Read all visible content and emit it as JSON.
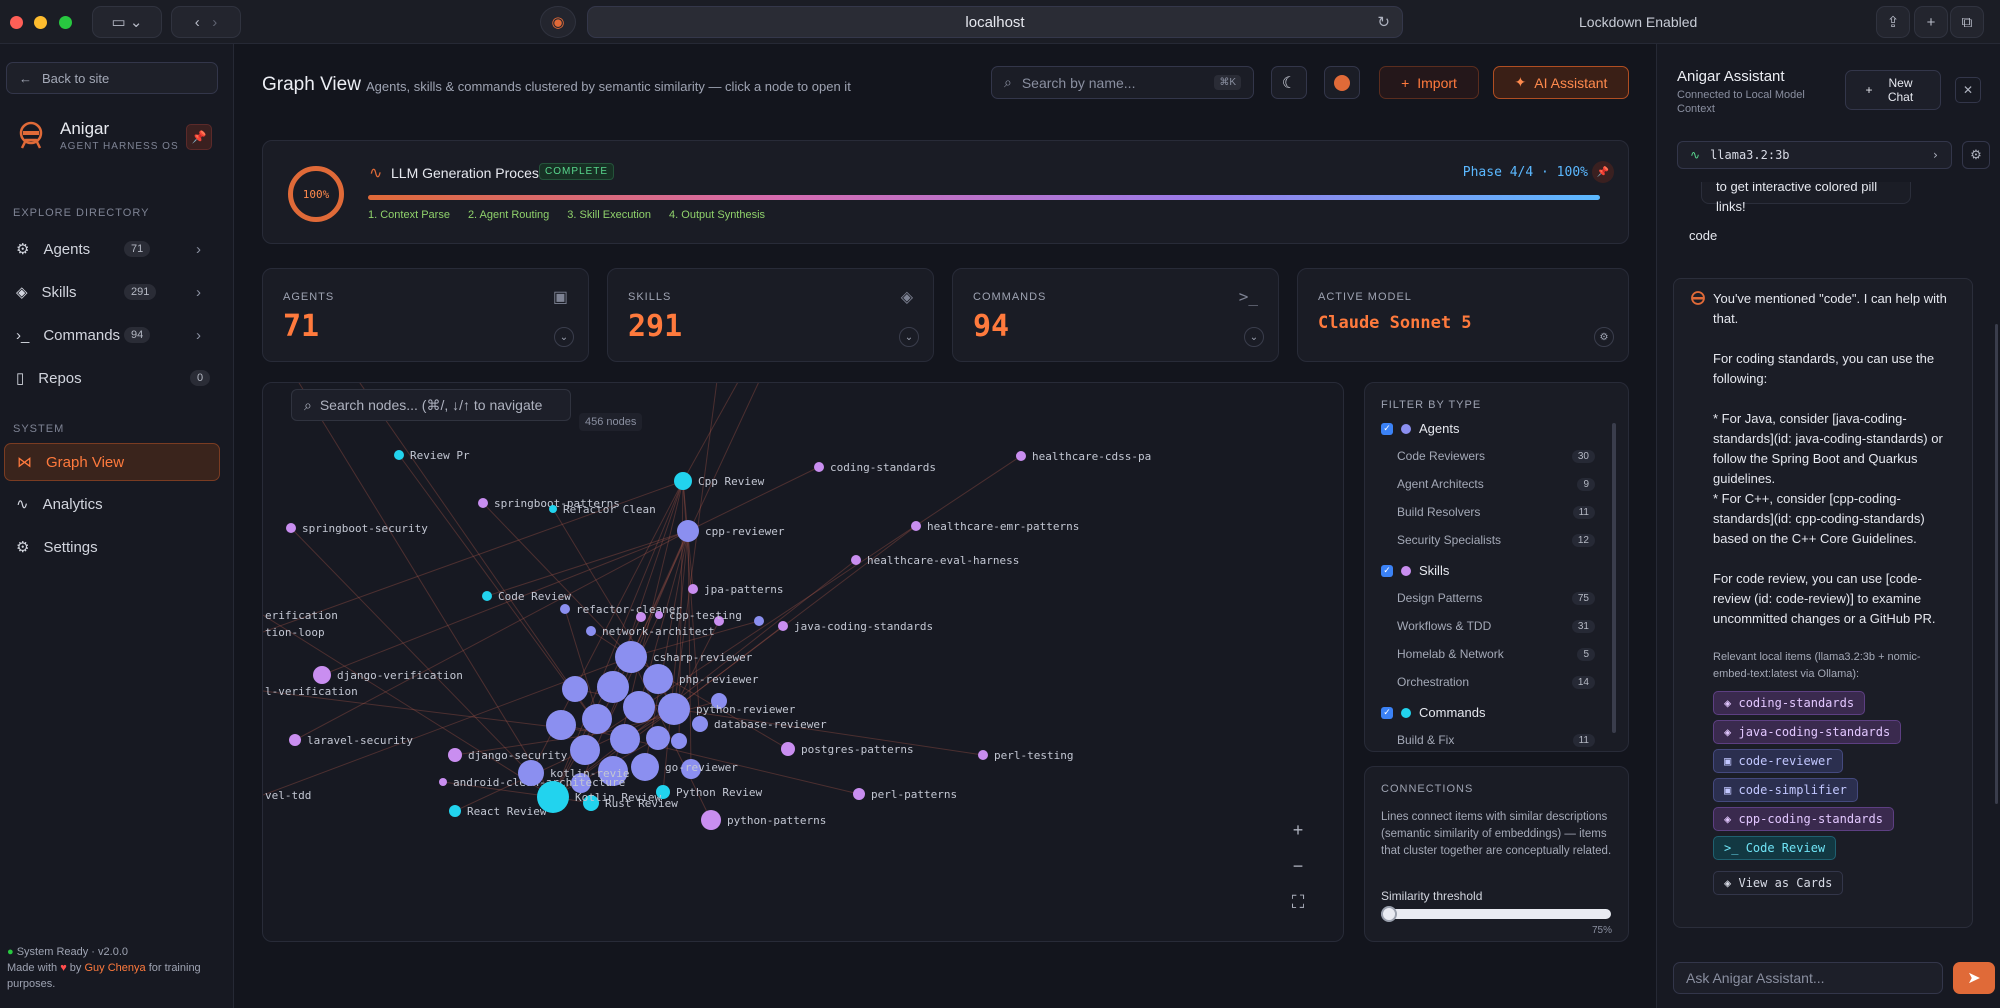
{
  "browser": {
    "url": "localhost",
    "lockdown": "Lockdown Enabled"
  },
  "sidebar": {
    "back": "Back to site",
    "brand": "Anigar",
    "brand_sub": "AGENT HARNESS OS",
    "explore_label": "EXPLORE DIRECTORY",
    "items": [
      {
        "label": "Agents",
        "count": "71"
      },
      {
        "label": "Skills",
        "count": "291"
      },
      {
        "label": "Commands",
        "count": "94"
      },
      {
        "label": "Repos",
        "count": "0"
      }
    ],
    "system_label": "SYSTEM",
    "system_items": [
      {
        "label": "Graph View"
      },
      {
        "label": "Analytics"
      },
      {
        "label": "Settings"
      }
    ],
    "status": "System Ready · v2.0.0",
    "made_with": "Made with",
    "by": "by",
    "author": "Guy Chenya",
    "purpose": "for training purposes."
  },
  "header": {
    "title": "Graph View",
    "subtitle": "Agents, skills & commands clustered by semantic similarity — click a node to open it",
    "search_placeholder": "Search by name...",
    "search_kbd": "⌘K",
    "import": "Import",
    "ai": "AI Assistant"
  },
  "process": {
    "ring": "100%",
    "title": "LLM Generation Process",
    "badge": "COMPLETE",
    "phase": "Phase 4/4 · 100%",
    "progress": 1.0,
    "steps": [
      "1. Context Parse",
      "2. Agent Routing",
      "3. Skill Execution",
      "4. Output Synthesis"
    ]
  },
  "stats": [
    {
      "label": "AGENTS",
      "value": "71"
    },
    {
      "label": "SKILLS",
      "value": "291"
    },
    {
      "label": "COMMANDS",
      "value": "94"
    },
    {
      "label": "ACTIVE MODEL",
      "value": "Claude Sonnet 5"
    }
  ],
  "graph": {
    "search_placeholder": "Search nodes... (⌘/, ↓/↑ to navigate",
    "count": "456 nodes",
    "labels": [
      "Review Pr",
      "springboot-patterns",
      "Refactor Clean",
      "springboot-security",
      "Cpp Review",
      "coding-standards",
      "healthcare-cdss-pa",
      "cpp-reviewer",
      "healthcare-emr-patterns",
      "healthcare-eval-harness",
      "jpa-patterns",
      "Code Review",
      "refactor-cleaner",
      "network-architect",
      "java-coding-standards",
      "erification",
      "tion-loop",
      "django-verification",
      "l-verification",
      "csharp-reviewer",
      "php-reviewer",
      "python-reviewer",
      "database-reviewer",
      "laravel-security",
      "django-security",
      "postgres-patterns",
      "perl-testing",
      "android-clean-architecture",
      "kotlin-revie",
      "Python Review",
      "perl-patterns",
      "vel-tdd",
      "React Review",
      "Rust Review",
      "Kotlin Review",
      "go-reviewer",
      "cpp-testing",
      "python-patterns"
    ]
  },
  "filter": {
    "title": "FILTER BY TYPE",
    "groups": [
      {
        "name": "Agents",
        "color": "#8b8ff0",
        "items": [
          {
            "label": "Code Reviewers",
            "count": "30"
          },
          {
            "label": "Agent Architects",
            "count": "9"
          },
          {
            "label": "Build Resolvers",
            "count": "11"
          },
          {
            "label": "Security Specialists",
            "count": "12"
          }
        ]
      },
      {
        "name": "Skills",
        "color": "#c98ef0",
        "items": [
          {
            "label": "Design Patterns",
            "count": "75"
          },
          {
            "label": "Workflows & TDD",
            "count": "31"
          },
          {
            "label": "Homelab & Network",
            "count": "5"
          },
          {
            "label": "Orchestration",
            "count": "14"
          }
        ]
      },
      {
        "name": "Commands",
        "color": "#22d3ee",
        "items": [
          {
            "label": "Build & Fix",
            "count": "11"
          }
        ]
      }
    ]
  },
  "connections": {
    "title": "CONNECTIONS",
    "text": "Lines connect items with similar descriptions (semantic similarity of embeddings) — items that cluster together are conceptually related.",
    "threshold_label": "Similarity threshold",
    "threshold_value": "75%"
  },
  "assistant": {
    "title": "Anigar Assistant",
    "subtitle": "Connected to Local Model Context",
    "new_chat": "New Chat",
    "model": "llama3.2:3b",
    "prev_tail": "to get interactive colored pill links!",
    "user_msg": "code",
    "reply": [
      "You've mentioned \"code\". I can help with that.",
      "For coding standards, you can use the following:",
      "* For Java, consider [java-coding-standards](id: java-coding-standards) or follow the Spring Boot and Quarkus guidelines.",
      "* For C++, consider [cpp-coding-standards](id: cpp-coding-standards) based on the C++ Core Guidelines.",
      "For code review, you can use [code-review (id: code-review)] to examine uncommitted changes or a GitHub PR."
    ],
    "local_note": "Relevant local items (llama3.2:3b + nomic-embed-text:latest via Ollama):",
    "pills": [
      {
        "label": "coding-standards",
        "kind": "skill"
      },
      {
        "label": "java-coding-standards",
        "kind": "skill"
      },
      {
        "label": "code-reviewer",
        "kind": "agent"
      },
      {
        "label": "code-simplifier",
        "kind": "agent"
      },
      {
        "label": "cpp-coding-standards",
        "kind": "skill"
      },
      {
        "label": "Code Review",
        "kind": "cmd"
      }
    ],
    "view_cards": "View as Cards",
    "input_placeholder": "Ask Anigar Assistant..."
  }
}
